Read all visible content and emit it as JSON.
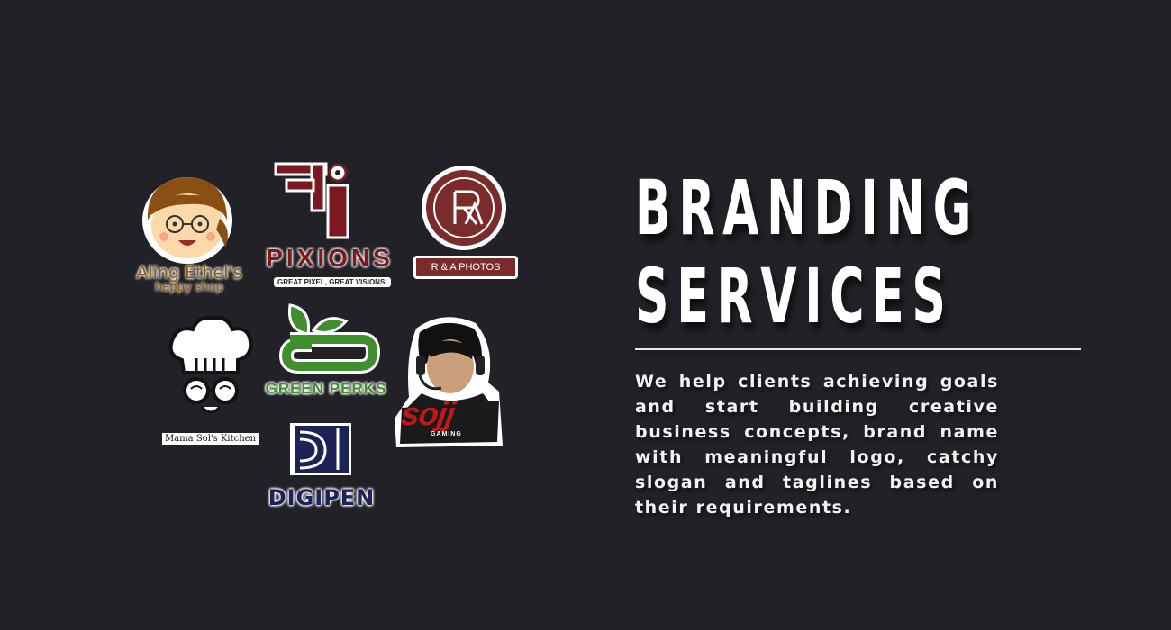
{
  "heading": {
    "line1": "BRANDING",
    "line2": "SERVICES"
  },
  "description": "We help clients achieving goals and start building cre­ative business concepts, brand name with meaningful logo, catchy slogan and taglines based on their requirements.",
  "logos": {
    "aling_ethel": {
      "name": "Aling Ethel's",
      "tagline": "happy shop"
    },
    "pixions": {
      "name": "PIXIONS",
      "tagline": "GREAT PIXEL, GREAT VISIONS!"
    },
    "ra_photos": {
      "name": "R & A PHOTOS"
    },
    "mama_sol": {
      "name": "Mama Sol's Kitchen"
    },
    "green_perks": {
      "name": "GREEN PERKS"
    },
    "sojj": {
      "name": "SOJJ",
      "tagline": "GAMING"
    },
    "digipen": {
      "name": "DIGIPEN"
    }
  },
  "colors": {
    "background": "#222127",
    "pixions_red": "#7a1a1f",
    "ra_red": "#7b2b2a",
    "green": "#3f8f2e",
    "sojj_red": "#c0171b",
    "digipen_navy": "#1d2257",
    "ethel_brown": "#8a5a12"
  }
}
